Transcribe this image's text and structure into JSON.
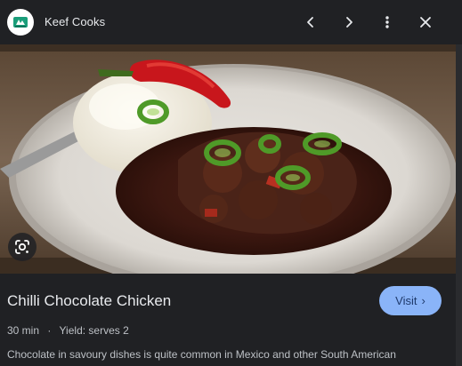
{
  "header": {
    "site_name": "Keef Cooks",
    "logo_icon": "keef-cooks-logo",
    "actions": [
      "chevron-left-icon",
      "chevron-right-icon",
      "more-vert-icon",
      "close-icon"
    ]
  },
  "image": {
    "alt": "Chilli Chocolate Chicken with rice and green chilli slices",
    "lens_icon": "google-lens-icon"
  },
  "recipe": {
    "title": "Chilli Chocolate Chicken",
    "time": "30 min",
    "separator": "·",
    "yield": "Yield: serves 2",
    "description": "Chocolate in savoury dishes is quite common in Mexico and other South American"
  },
  "visit": {
    "label": "Visit",
    "chevron": "›"
  },
  "colors": {
    "background": "#202124",
    "accent": "#8ab4f8",
    "text_primary": "#e8eaed",
    "text_secondary": "#bdc1c6"
  }
}
